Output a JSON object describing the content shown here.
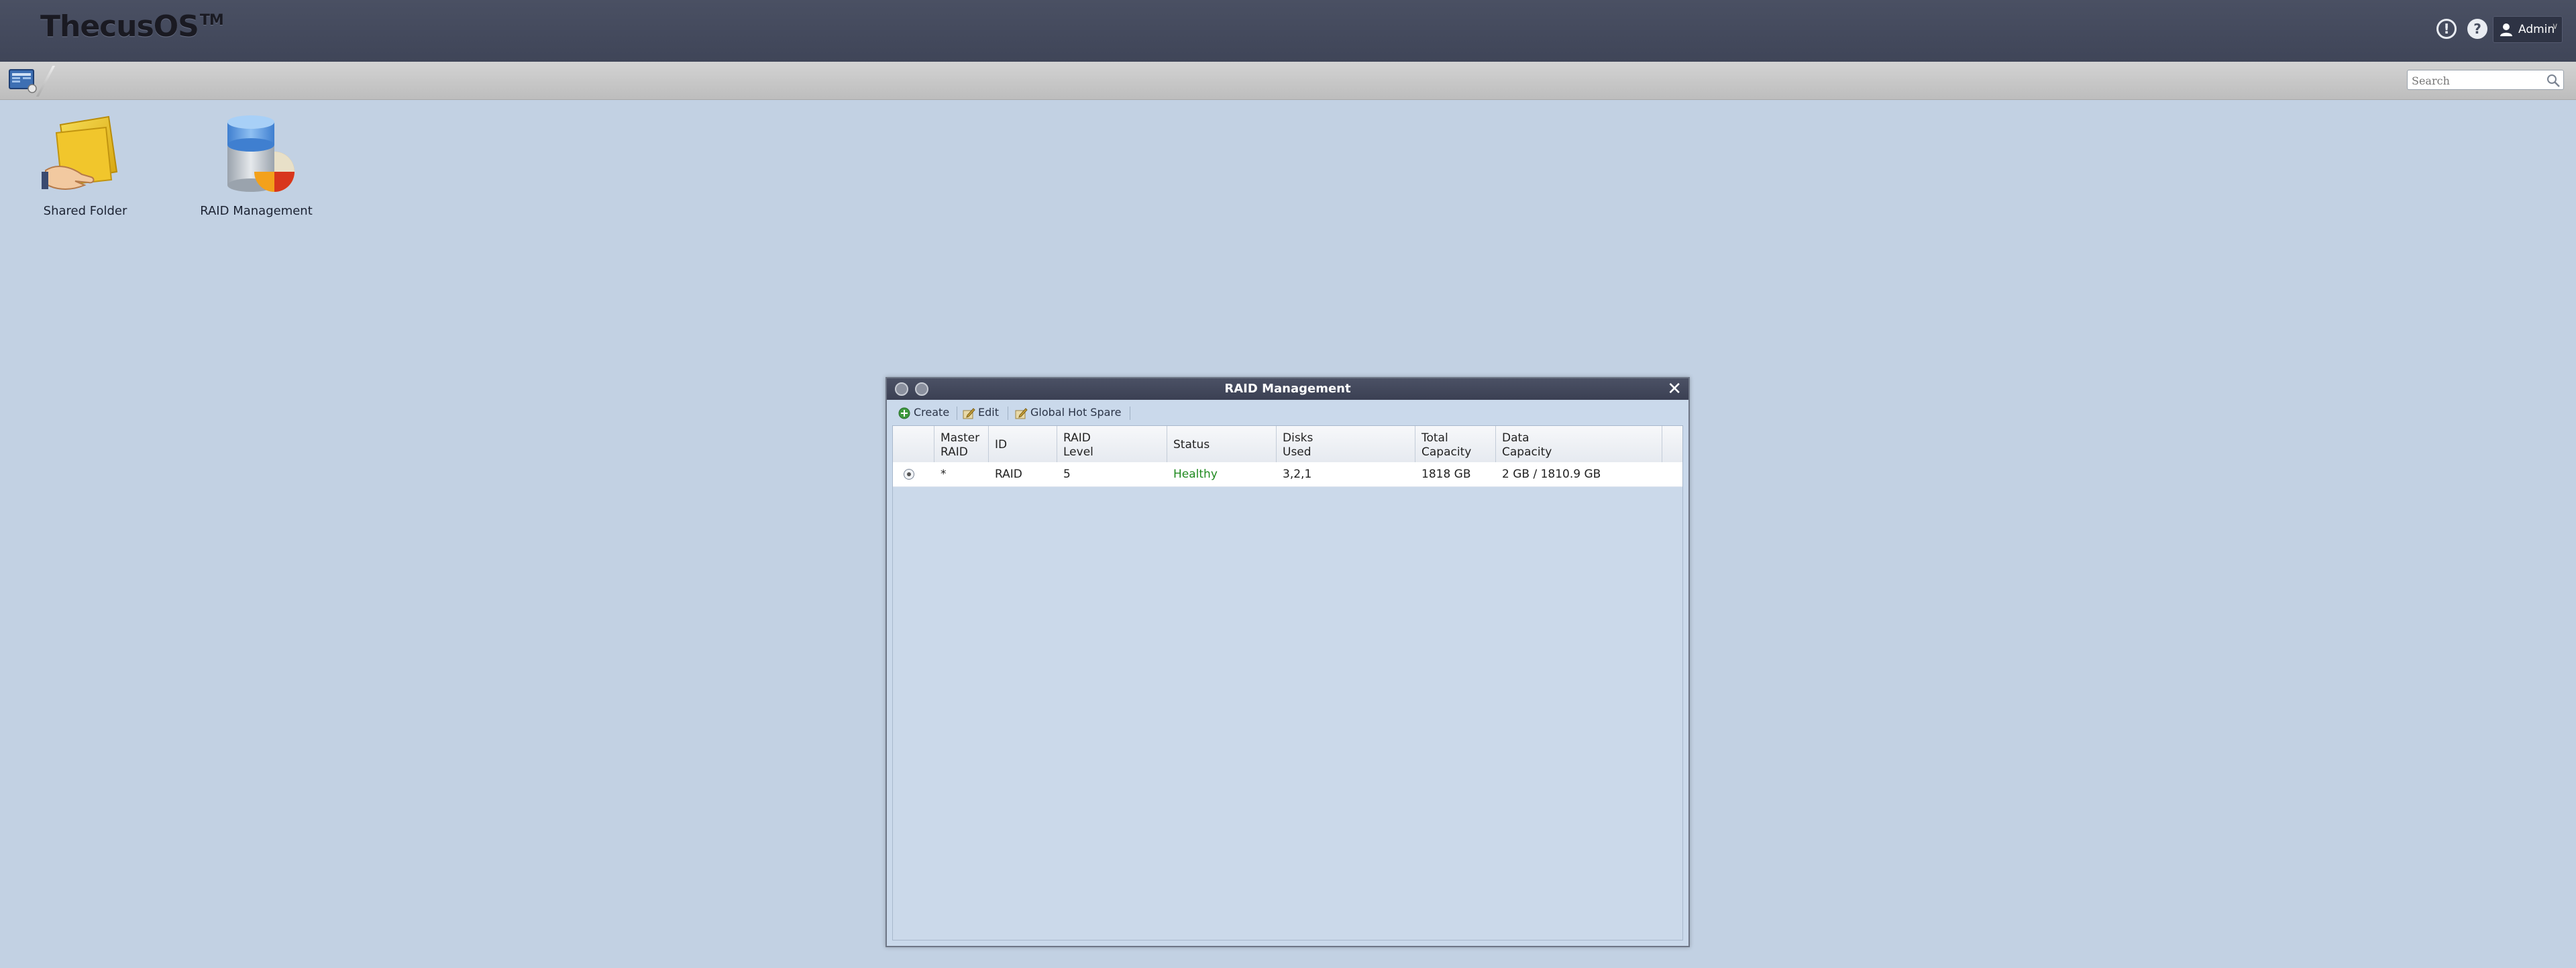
{
  "header": {
    "logo_text": "ThecusOS",
    "logo_mark": "TM",
    "notice_icon": "exclamation-circle-icon",
    "help_icon": "question-circle-icon",
    "user_label": "Admin"
  },
  "taskbar": {
    "search_placeholder": "Search"
  },
  "desktop": {
    "items": [
      {
        "label": "Shared Folder",
        "icon": "shared-folder-icon"
      },
      {
        "label": "RAID Management",
        "icon": "raid-management-icon"
      }
    ]
  },
  "raid_window": {
    "title": "RAID Management",
    "close_glyph": "✕",
    "toolbar": {
      "create": "Create",
      "edit": "Edit",
      "global_hot_spare": "Global Hot Spare"
    },
    "columns": {
      "master_raid": [
        "Master",
        "RAID"
      ],
      "id": [
        "ID"
      ],
      "raid_level": [
        "RAID",
        "Level"
      ],
      "status": [
        "Status"
      ],
      "disks_used": [
        "Disks",
        "Used"
      ],
      "total_capacity": [
        "Total",
        "Capacity"
      ],
      "data_capacity": [
        "Data",
        "Capacity"
      ]
    },
    "rows": [
      {
        "selected": true,
        "master_raid": "*",
        "id": "RAID",
        "raid_level": "5",
        "status": "Healthy",
        "disks_used": "3,2,1",
        "total_capacity": "1818 GB",
        "data_capacity": "2 GB / 1810.9 GB"
      }
    ]
  },
  "colors": {
    "desktop_bg": "#c2d1e3",
    "header_bg": "#454b5e",
    "status_healthy": "#1f8a1f"
  }
}
